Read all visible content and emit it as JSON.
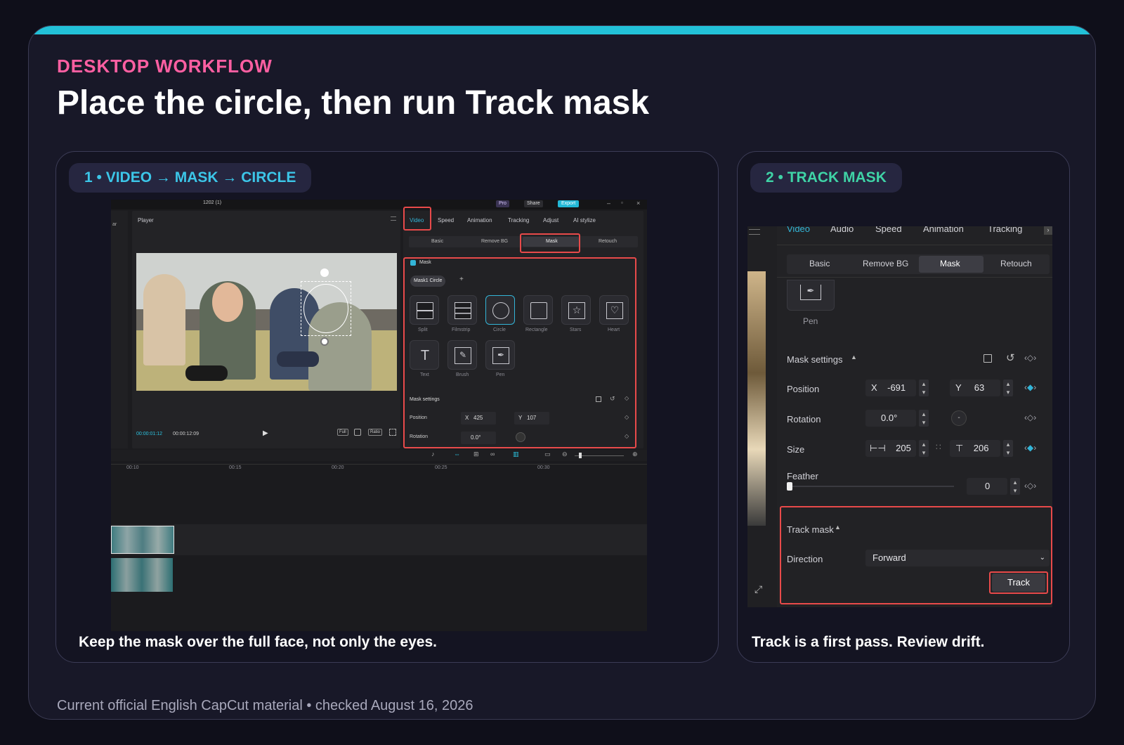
{
  "header": {
    "eyebrow": "DESKTOP WORKFLOW",
    "title": "Place the circle, then run Track mask"
  },
  "footer": "Current official English CapCut material • checked August 16, 2026",
  "colors": {
    "accent_bar": "#22c1d8",
    "eyebrow": "#ff5fa2",
    "highlight": "#e84a4a",
    "selected": "#33b5d8"
  },
  "step1": {
    "label": "1 • VIDEO → MASK → CIRCLE",
    "caption": "Keep the mask over the full face, not only the eyes.",
    "editor": {
      "project_name": "1202 (1)",
      "pro_label": "Pro",
      "share_label": "Share",
      "export_label": "Export",
      "player_label": "Player",
      "sidebar_stub": "ar",
      "time_current": "00:00:01:12",
      "time_total": "00:00:12:09",
      "btn_full": "Full",
      "btn_ratio": "Ratio",
      "tabs": [
        "Video",
        "Speed",
        "Animation",
        "Tracking",
        "Adjust",
        "AI stylize"
      ],
      "subtabs": [
        "Basic",
        "Remove BG",
        "Mask",
        "Retouch"
      ],
      "mask_header": "Mask",
      "mask_chip": "Mask1 Circle",
      "shapes_row1": [
        "Split",
        "Filmstrip",
        "Circle",
        "Rectangle",
        "Stars",
        "Heart"
      ],
      "shapes_row2": [
        "Text",
        "Brush",
        "Pen"
      ],
      "settings_label": "Mask settings",
      "position_label": "Position",
      "pos_x_label": "X",
      "pos_x": "425",
      "pos_y_label": "Y",
      "pos_y": "107",
      "rotation_label": "Rotation",
      "rotation": "0.0°",
      "timeline_ticks": [
        "00:10",
        "00:15",
        "00:20",
        "00:25",
        "00:30"
      ]
    }
  },
  "step2": {
    "label": "2 • TRACK MASK",
    "caption": "Track is a first pass. Review drift.",
    "editor": {
      "tabs": [
        "Video",
        "Audio",
        "Speed",
        "Animation",
        "Tracking"
      ],
      "subtabs": [
        "Basic",
        "Remove BG",
        "Mask",
        "Retouch"
      ],
      "pen_label": "Pen",
      "settings_label": "Mask settings",
      "position_label": "Position",
      "x_label": "X",
      "x_value": "-691",
      "y_label": "Y",
      "y_value": "63",
      "rotation_label": "Rotation",
      "rotation_value": "0.0°",
      "size_label": "Size",
      "width_value": "205",
      "height_value": "206",
      "feather_label": "Feather",
      "feather_value": "0",
      "feather_level": 0,
      "track_section_label": "Track mask",
      "direction_label": "Direction",
      "direction_value": "Forward",
      "track_button": "Track"
    }
  }
}
